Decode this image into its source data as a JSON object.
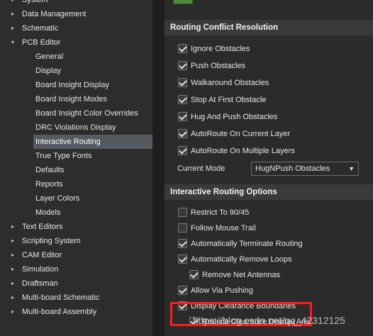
{
  "tree": {
    "items": [
      {
        "label": "System",
        "arrow": "▸",
        "child": false
      },
      {
        "label": "Data Management",
        "arrow": "▸",
        "child": false
      },
      {
        "label": "Schematic",
        "arrow": "▸",
        "child": false
      },
      {
        "label": "PCB Editor",
        "arrow": "▾",
        "child": false
      },
      {
        "label": "General",
        "child": true
      },
      {
        "label": "Display",
        "child": true
      },
      {
        "label": "Board Insight Display",
        "child": true
      },
      {
        "label": "Board Insight Modes",
        "child": true
      },
      {
        "label": "Board Insight Color Overrides",
        "child": true
      },
      {
        "label": "DRC Violations Display",
        "child": true
      },
      {
        "label": "Interactive Routing",
        "child": true,
        "selected": true
      },
      {
        "label": "True Type Fonts",
        "child": true
      },
      {
        "label": "Defaults",
        "child": true
      },
      {
        "label": "Reports",
        "child": true
      },
      {
        "label": "Layer Colors",
        "child": true
      },
      {
        "label": "Models",
        "child": true
      },
      {
        "label": "Text Editors",
        "arrow": "▸",
        "child": false
      },
      {
        "label": "Scripting System",
        "arrow": "▸",
        "child": false
      },
      {
        "label": "CAM Editor",
        "arrow": "▸",
        "child": false
      },
      {
        "label": "Simulation",
        "arrow": "▸",
        "child": false
      },
      {
        "label": "Draftsman",
        "arrow": "▸",
        "child": false
      },
      {
        "label": "Multi-board Schematic",
        "arrow": "▸",
        "child": false
      },
      {
        "label": "Multi-board Assembly",
        "arrow": "▸",
        "child": false
      }
    ]
  },
  "routing_conflict": {
    "title": "Routing Conflict Resolution",
    "options": [
      {
        "label": "Ignore Obstacles",
        "checked": true
      },
      {
        "label": "Push Obstacles",
        "checked": true
      },
      {
        "label": "Walkaround Obstacles",
        "checked": true
      },
      {
        "label": "Stop At First Obstacle",
        "checked": true
      },
      {
        "label": "Hug And Push Obstacles",
        "checked": true
      },
      {
        "label": "AutoRoute On Current Layer",
        "checked": true
      },
      {
        "label": "AutoRoute On Multiple Layers",
        "checked": true
      }
    ],
    "mode_label": "Current Mode",
    "mode_value": "HugNPush Obstacles"
  },
  "interactive_options": {
    "title": "Interactive Routing Options",
    "options": [
      {
        "label": "Restrict To 90/45",
        "checked": false,
        "indent": false
      },
      {
        "label": "Follow Mouse Trail",
        "checked": false,
        "indent": false
      },
      {
        "label": "Automatically Terminate Routing",
        "checked": true,
        "indent": false
      },
      {
        "label": "Automatically Remove Loops",
        "checked": true,
        "indent": false
      },
      {
        "label": "Remove Net Antennas",
        "checked": true,
        "indent": true
      },
      {
        "label": "Allow Via Pushing",
        "checked": true,
        "indent": false
      },
      {
        "label": "Display Clearance Boundaries",
        "checked": true,
        "indent": false
      },
      {
        "label": "Reduce Clearance Display Area",
        "checked": true,
        "indent": true
      }
    ]
  },
  "watermark": "https://blog.csdn.net/qq_42312125",
  "colors": {
    "highlight": "#ff1c1c",
    "selection": "#555a60"
  }
}
